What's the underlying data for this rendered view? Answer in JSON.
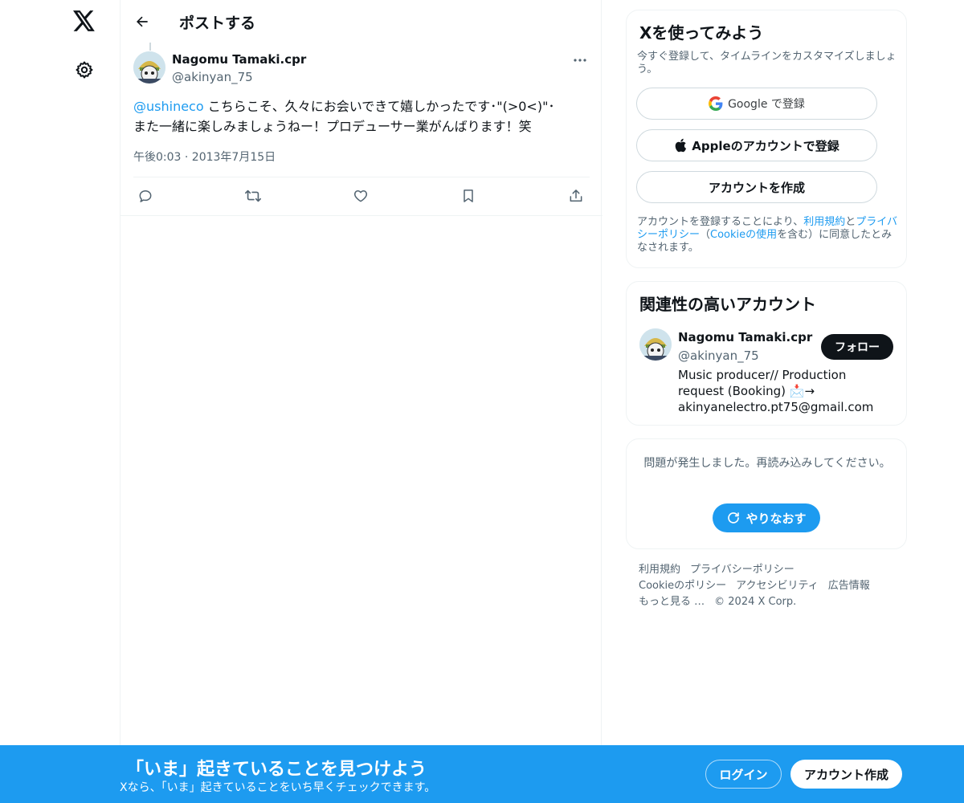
{
  "nav": {
    "logo_icon": "x-logo-icon",
    "settings_icon": "gear-icon"
  },
  "header": {
    "title": "ポストする",
    "back_icon": "arrow-left-icon"
  },
  "post": {
    "author_name": "Nagomu Tamaki.cpr",
    "author_handle": "@akinyan_75",
    "mention": "@ushineco",
    "text_line1": " こちらこそ、久々にお会いできて嬉しかったです･\"(>0<)\"･",
    "text_line2": "また一緒に楽しみましょうねー！プロデューサー業がんばります！笑",
    "timestamp": "午後0:03 · 2013年7月15日",
    "actions": [
      "reply-icon",
      "repost-icon",
      "like-icon",
      "bookmark-icon",
      "share-icon"
    ]
  },
  "signup_card": {
    "title": "Xを使ってみよう",
    "subtitle": "今すぐ登録して、タイムラインをカスタマイズしましょう。",
    "google_label": "Google で登録",
    "apple_label": "Appleのアカウントで登録",
    "create_label": "アカウントを作成",
    "legal_prefix": "アカウントを登録することにより、",
    "legal_terms": "利用規約",
    "legal_and": "と",
    "legal_privacy": "プライバシーポリシー",
    "legal_mid": "（",
    "legal_cookie": "Cookieの使用",
    "legal_suffix": "を含む）に同意したとみなされます。"
  },
  "related": {
    "title": "関連性の高いアカウント",
    "name": "Nagomu Tamaki.cpr",
    "handle": "@akinyan_75",
    "follow_label": "フォロー",
    "bio": "Music producer// Production request (Booking) 📩→ akinyanelectro.pt75@gmail.com"
  },
  "error_card": {
    "message": "問題が発生しました。再読み込みしてください。",
    "retry_label": "やりなおす"
  },
  "footer": {
    "links": [
      "利用規約",
      "プライバシーポリシー",
      "Cookieのポリシー",
      "アクセシビリティ",
      "広告情報",
      "もっと見る …",
      "© 2024 X Corp."
    ]
  },
  "bottom_bar": {
    "title": "「いま」起きていることを見つけよう",
    "subtitle": "Xなら、「いま」起きていることをいち早くチェックできます。",
    "login_label": "ログイン",
    "signup_label": "アカウント作成"
  },
  "colors": {
    "accent": "#1d9bf0",
    "text": "#0f1419",
    "muted": "#536471",
    "border": "#eff3f4"
  }
}
